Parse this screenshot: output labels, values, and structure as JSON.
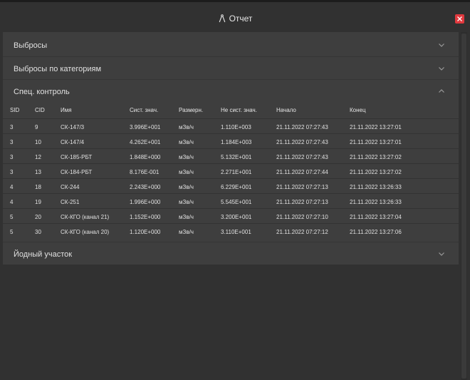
{
  "window": {
    "title": "Отчет",
    "icon": "compass-icon",
    "close_icon": "close-icon",
    "close_color": "#e0393e"
  },
  "sections": {
    "emissions": {
      "label": "Выбросы",
      "expanded": false
    },
    "emissions_by_category": {
      "label": "Выбросы по категориям",
      "expanded": false
    },
    "special_control": {
      "label": "Спец. контроль",
      "expanded": true
    },
    "iodine_area": {
      "label": "Йодный участок",
      "expanded": false
    }
  },
  "table": {
    "headers": {
      "sid": "SID",
      "cid": "CID",
      "name": "Имя",
      "sys_value": "Сист. знач.",
      "unit": "Размерн.",
      "nonsys_value": "Не сист. знач.",
      "start": "Начало",
      "end": "Конец"
    },
    "rows": [
      {
        "sid": "3",
        "cid": "9",
        "name": "СК-147/3",
        "sys_value": "3.996E+001",
        "unit": "мЗв/ч",
        "nonsys_value": "1.110E+003",
        "start": "21.11.2022 07:27:43",
        "end": "21.11.2022 13:27:01"
      },
      {
        "sid": "3",
        "cid": "10",
        "name": "СК-147/4",
        "sys_value": "4.262E+001",
        "unit": "мЗв/ч",
        "nonsys_value": "1.184E+003",
        "start": "21.11.2022 07:27:43",
        "end": "21.11.2022 13:27:01"
      },
      {
        "sid": "3",
        "cid": "12",
        "name": "СК-185-РБТ",
        "sys_value": "1.848E+000",
        "unit": "мЗв/ч",
        "nonsys_value": "5.132E+001",
        "start": "21.11.2022 07:27:43",
        "end": "21.11.2022 13:27:02"
      },
      {
        "sid": "3",
        "cid": "13",
        "name": "СК-184-РБТ",
        "sys_value": "8.176E-001",
        "unit": "мЗв/ч",
        "nonsys_value": "2.271E+001",
        "start": "21.11.2022 07:27:44",
        "end": "21.11.2022 13:27:02"
      },
      {
        "sid": "4",
        "cid": "18",
        "name": "СК-244",
        "sys_value": "2.243E+000",
        "unit": "мЗв/ч",
        "nonsys_value": "6.229E+001",
        "start": "21.11.2022 07:27:13",
        "end": "21.11.2022 13:26:33"
      },
      {
        "sid": "4",
        "cid": "19",
        "name": "СК-251",
        "sys_value": "1.996E+000",
        "unit": "мЗв/ч",
        "nonsys_value": "5.545E+001",
        "start": "21.11.2022 07:27:13",
        "end": "21.11.2022 13:26:33"
      },
      {
        "sid": "5",
        "cid": "20",
        "name": "СК-КГО (канал 21)",
        "sys_value": "1.152E+000",
        "unit": "мЗв/ч",
        "nonsys_value": "3.200E+001",
        "start": "21.11.2022 07:27:10",
        "end": "21.11.2022 13:27:04"
      },
      {
        "sid": "5",
        "cid": "30",
        "name": "СК-КГО (канал 20)",
        "sys_value": "1.120E+000",
        "unit": "мЗв/ч",
        "nonsys_value": "3.110E+001",
        "start": "21.11.2022 07:27:12",
        "end": "21.11.2022 13:27:06"
      }
    ]
  }
}
